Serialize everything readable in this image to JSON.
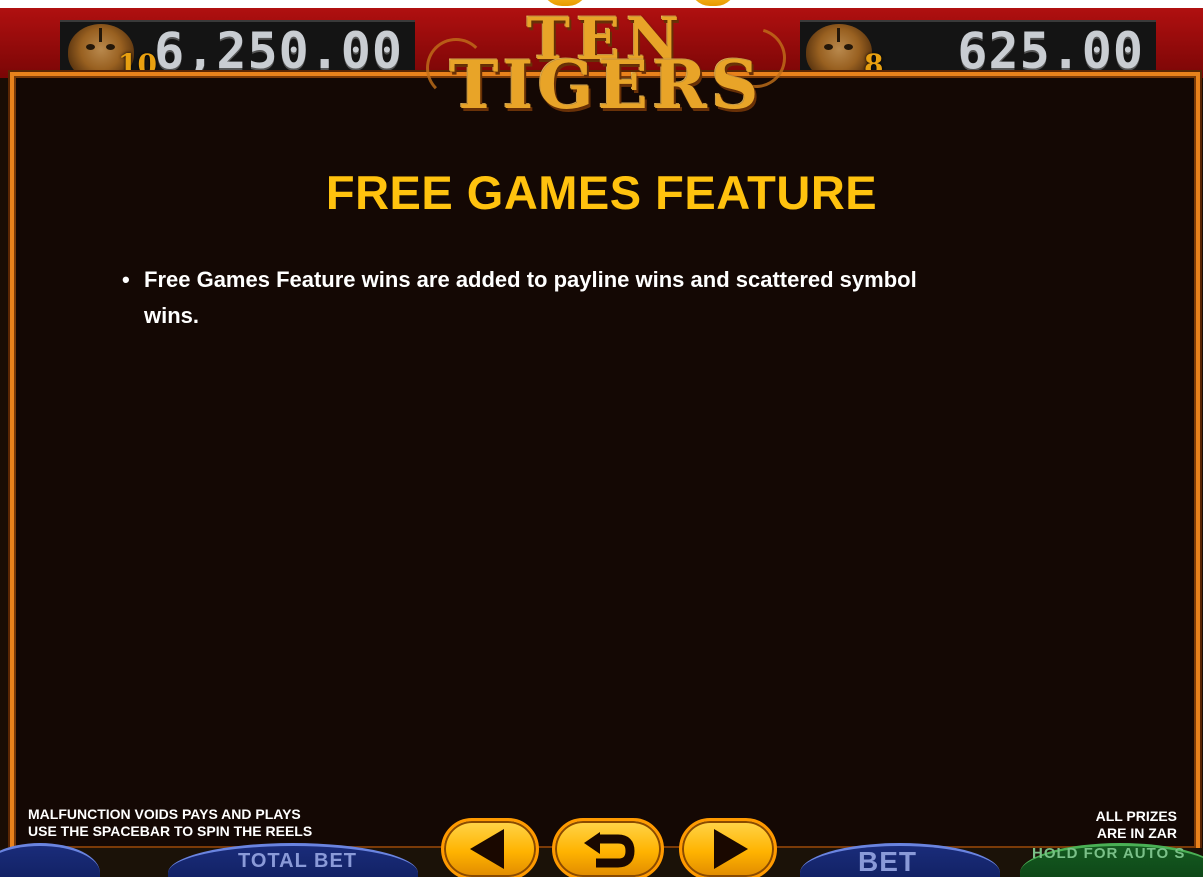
{
  "jackpots": {
    "left": {
      "value": "6,250.00",
      "multiplier": "10"
    },
    "right": {
      "value": "625.00",
      "multiplier": "8"
    }
  },
  "logo": {
    "line1": "TEN",
    "line2": "TIGERS"
  },
  "page": {
    "title": "FREE GAMES FEATURE",
    "bullets": [
      "Free Games Feature wins are added to payline wins and scattered symbol wins."
    ]
  },
  "footer": {
    "left_line1": "MALFUNCTION VOIDS PAYS AND PLAYS",
    "left_line2": "USE THE SPACEBAR TO SPIN THE REELS",
    "right_line1": "ALL PRIZES",
    "right_line2": "ARE IN ZAR"
  },
  "controls": {
    "total_bet_label": "TOTAL BET",
    "bet_label": "BET",
    "auto_label": "HOLD FOR AUTO S"
  },
  "nav": {
    "prev_icon": "triangle-left-icon",
    "back_icon": "return-arrow-icon",
    "next_icon": "triangle-right-icon"
  },
  "colors": {
    "title": "#ffc20e",
    "panel_border": "#e8821c",
    "button": "#ffb300",
    "jackpot_bar": "#b01010"
  }
}
